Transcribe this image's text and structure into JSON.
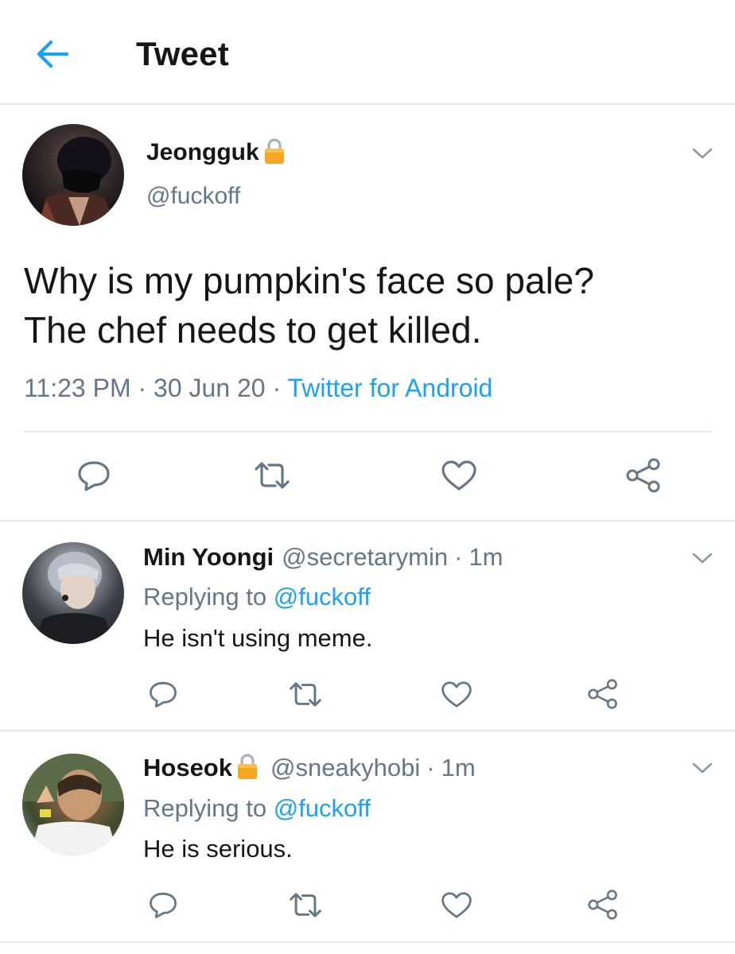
{
  "header": {
    "title": "Tweet",
    "back_icon": "arrow-left-icon",
    "accent_color": "#1da1f2"
  },
  "tweet": {
    "name": "Jeongguk",
    "handle": "@fuckoff",
    "locked": true,
    "text_line1": "Why is my pumpkin's face so pale?",
    "text_line2": "The chef needs to get killed.",
    "time": "11:23 PM",
    "date": "30 Jun 20",
    "separator": " · ",
    "source": "Twitter for Android"
  },
  "replies": [
    {
      "name": "Min Yoongi",
      "handle": "@secretarymin",
      "time": "1m",
      "locked": false,
      "replying_label": "Replying to",
      "mention": "@fuckoff",
      "text": "He isn't using meme."
    },
    {
      "name": "Hoseok",
      "handle": "@sneakyhobi",
      "time": "1m",
      "locked": true,
      "replying_label": "Replying to",
      "mention": "@fuckoff",
      "text": "He is serious."
    }
  ],
  "icons": {
    "reply": "reply-icon",
    "retweet": "retweet-icon",
    "like": "heart-icon",
    "share": "share-icon",
    "more": "chevron-down-icon",
    "lock": "lock-icon"
  },
  "colors": {
    "text": "#14171a",
    "secondary": "#657786",
    "link": "#1da1f2",
    "divider": "#e1e8ed",
    "lock": "#f5a623"
  }
}
